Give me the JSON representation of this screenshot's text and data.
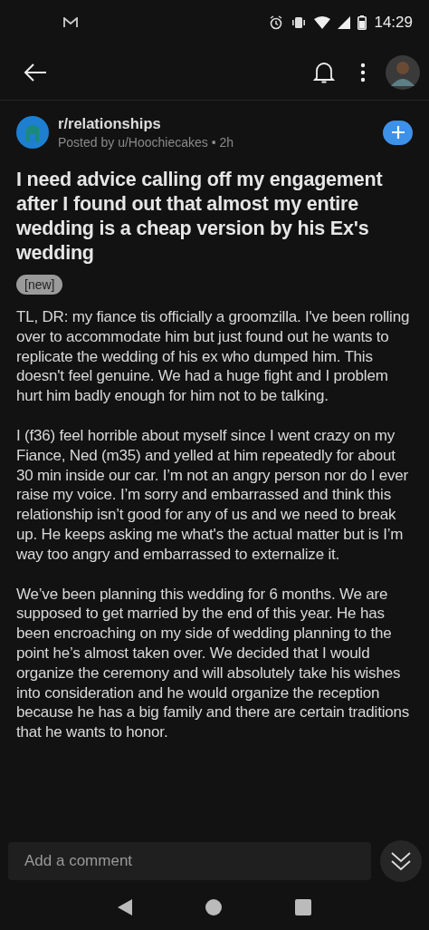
{
  "status_bar": {
    "time": "14:29"
  },
  "post": {
    "subreddit": "r/relationships",
    "meta": "Posted by u/Hoochiecakes • 2h",
    "title": "I need advice calling off my engagement after I found out that almost my entire wedding is a cheap version by his Ex's wedding",
    "flair": "[new]",
    "paragraphs": [
      "TL, DR: my fiance tis officially a groomzilla. I've been rolling over to accommodate him but just found out he wants to replicate the wedding of his ex who dumped him. This doesn't feel genuine. We had a huge fight and I problem hurt him badly enough for him not to be talking.",
      "I (f36) feel horrible about myself since I went crazy on my Fiance, Ned (m35) and yelled at him repeatedly for about 30 min inside our car. I’m not an angry person nor do I ever raise my voice. I’m sorry and embarrassed and think this relationship isn’t good for any of us and we need to break up. He keeps asking me what's the actual matter but is I’m way too angry and embarrassed to externalize it.",
      "We’ve been planning this wedding for 6 months. We are supposed to get married by the end of this year. He has been encroaching on my side of wedding planning to the point he’s almost taken over. We decided that I would organize the ceremony and will absolutely take his wishes into consideration and he would organize the reception because he has a big family and there are certain traditions that he wants to honor."
    ]
  },
  "comment_field": {
    "placeholder": "Add a comment"
  }
}
